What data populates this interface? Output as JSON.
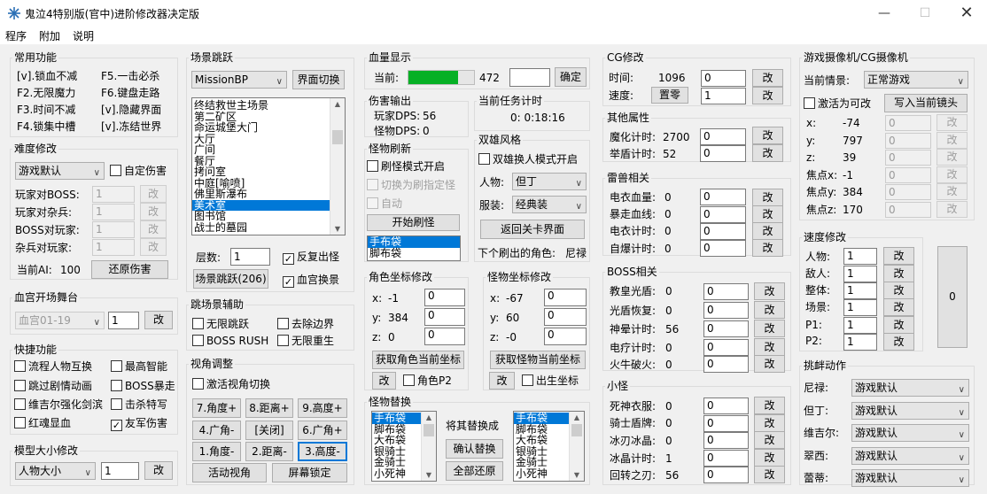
{
  "title": "鬼泣4特别版(官中)进阶修改器决定版",
  "menu": [
    "程序",
    "附加",
    "说明"
  ],
  "common": {
    "title": "常用功能",
    "items": [
      "[v].锁血不减",
      "F5.一击必杀",
      "F2.无限魔力",
      "F6.键盘走路",
      "F3.时间不减",
      "[v].隐藏界面",
      "F4.锁集中槽",
      "[v].冻结世界"
    ]
  },
  "diff": {
    "title": "难度修改",
    "combo": "游戏默认",
    "custom": "自定伤害",
    "rows": [
      {
        "label": "玩家对BOSS:",
        "value": "1"
      },
      {
        "label": "玩家对杂兵:",
        "value": "1"
      },
      {
        "label": "BOSS对玩家:",
        "value": "1"
      },
      {
        "label": "杂兵对玩家:",
        "value": "1"
      }
    ],
    "ai_label": "当前AI:",
    "ai_value": "100",
    "reset": "还原伤害"
  },
  "change": "改",
  "blood_palace": {
    "title": "血宫开场舞台",
    "combo": "血宫01-19",
    "value": "1"
  },
  "quick": {
    "title": "快捷功能",
    "items": [
      "流程人物互换",
      "最高智能",
      "跳过剧情动画",
      "BOSS暴走",
      "维吉尔强化剑滨",
      "击杀特写",
      "红魂显血",
      "友军伤害"
    ]
  },
  "model": {
    "title": "模型大小修改",
    "combo": "人物大小",
    "value": "1"
  },
  "scene": {
    "title": "场景跳跃",
    "combo": "MissionBP",
    "switch": "界面切换",
    "list": [
      "终结救世主场景",
      "第二矿区",
      "命运城堡大门",
      "大厅",
      "广间",
      "餐厅",
      "拷问室",
      "中庭[喻喷]",
      "佛里斯瀑布",
      "美术室",
      "图书馆",
      "战士的墓园"
    ],
    "floor_label": "层数:",
    "floor_value": "1",
    "repeat": "反复出怪",
    "blood": "血宫换景",
    "jump": "场景跳跃(206)"
  },
  "assist": {
    "title": "跳场景辅助",
    "items": [
      "无限跳跃",
      "去除边界",
      "BOSS RUSH",
      "无限重生"
    ]
  },
  "view": {
    "title": "视角调整",
    "activate": "激活视角切换",
    "buttons": [
      "7.角度+",
      "8.距离+",
      "9.高度+",
      "4.广角-",
      "[关闭]",
      "6.广角+",
      "1.角度-",
      "2.距离-",
      "3.高度-"
    ],
    "active": "活动视角",
    "lock": "屏幕锁定"
  },
  "hp": {
    "title": "血量显示",
    "label": "当前:",
    "value": "472",
    "confirm": "确定",
    "fill": 0.75
  },
  "dmg": {
    "title": "伤害输出",
    "player": "玩家DPS:",
    "player_val": "56",
    "monster": "怪物DPS:",
    "monster_val": "0"
  },
  "timer": {
    "title": "当前任务计时",
    "value": "0: 0:18:16"
  },
  "refresh": {
    "title": "怪物刷新",
    "mode": "刷怪模式开启",
    "switch": "切换为刷指定怪",
    "auto": "自动",
    "start": "开始刷怪",
    "list": [
      "手布袋",
      "脚布袋"
    ]
  },
  "dual": {
    "title": "双雄风格",
    "enable": "双雄换人模式开启",
    "char_label": "人物:",
    "char": "但丁",
    "costume_label": "服装:",
    "costume": "经典装",
    "back": "返回关卡界面",
    "next_label": "下个刷出的角色:",
    "next": "尼禄"
  },
  "role_pos": {
    "title": "角色坐标修改",
    "x": "-1",
    "y": "384",
    "z": "0",
    "get": "获取角色当前坐标",
    "p2": "角色P2"
  },
  "mon_pos": {
    "title": "怪物坐标修改",
    "x": "-67",
    "y": "60",
    "z": "-0",
    "get": "获取怪物当前坐标",
    "spawn": "出生坐标"
  },
  "replace": {
    "title": "怪物替换",
    "list": [
      "手布袋",
      "脚布袋",
      "大布袋",
      "银骑士",
      "金骑士",
      "小死神"
    ],
    "label": "将其替换成",
    "confirm": "确认替换",
    "restore": "全部还原",
    "list2": [
      "手布袋",
      "脚布袋",
      "大布袋",
      "银骑士",
      "金骑士",
      "小死神"
    ]
  },
  "cg": {
    "title": "CG修改",
    "time_label": "时间:",
    "time_val": "1096",
    "speed_label": "速度:",
    "zero": "置零",
    "time_in": "0",
    "speed_in": "1"
  },
  "attr": {
    "title": "其他属性",
    "rows": [
      {
        "label": "魔化计时:",
        "val": "2700",
        "input": "0"
      },
      {
        "label": "举盾计时:",
        "val": "52",
        "input": "0"
      }
    ]
  },
  "thunder": {
    "title": "雷兽相关",
    "rows": [
      {
        "label": "电衣血量:",
        "val": "0",
        "input": "0"
      },
      {
        "label": "暴走血线:",
        "val": "0",
        "input": "0"
      },
      {
        "label": "电衣计时:",
        "val": "0",
        "input": "0"
      },
      {
        "label": "自爆计时:",
        "val": "0",
        "input": "0"
      }
    ]
  },
  "boss": {
    "title": "BOSS相关",
    "rows": [
      {
        "label": "教皇光盾:",
        "val": "0",
        "input": "0"
      },
      {
        "label": "光盾恢复:",
        "val": "0",
        "input": "0"
      },
      {
        "label": "神晕计时:",
        "val": "56",
        "input": "0"
      },
      {
        "label": "电疗计时:",
        "val": "0",
        "input": "0"
      },
      {
        "label": "火牛破火:",
        "val": "0",
        "input": "0"
      }
    ]
  },
  "minion": {
    "title": "小怪",
    "rows": [
      {
        "label": "死神衣服:",
        "val": "0",
        "input": "0"
      },
      {
        "label": "骑士盾牌:",
        "val": "0",
        "input": "0"
      },
      {
        "label": "冰刃冰晶:",
        "val": "0",
        "input": "0"
      },
      {
        "label": "冰晶计时:",
        "val": "1",
        "input": "0"
      },
      {
        "label": "回转之刃:",
        "val": "56",
        "input": "0"
      }
    ]
  },
  "cam": {
    "title": "游戏摄像机/CG摄像机",
    "scene_label": "当前情景:",
    "scene": "正常游戏",
    "activate": "激活为可改",
    "write": "写入当前镜头",
    "rows": [
      {
        "label": "x:",
        "val": "-74",
        "input": "0"
      },
      {
        "label": "y:",
        "val": "797",
        "input": "0"
      },
      {
        "label": "z:",
        "val": "39",
        "input": "0"
      },
      {
        "label": "焦点x:",
        "val": "-1",
        "input": "0"
      },
      {
        "label": "焦点y:",
        "val": "384",
        "input": "0"
      },
      {
        "label": "焦点z:",
        "val": "170",
        "input": "0"
      }
    ]
  },
  "speed": {
    "title": "速度修改",
    "rows": [
      {
        "label": "人物:",
        "input": "1"
      },
      {
        "label": "敌人:",
        "input": "1"
      },
      {
        "label": "整体:",
        "input": "1"
      },
      {
        "label": "场景:",
        "input": "1"
      },
      {
        "label": "P1:",
        "input": "1"
      },
      {
        "label": "P2:",
        "input": "1"
      }
    ],
    "side": "0"
  },
  "taunt": {
    "title": "挑衅动作",
    "rows": [
      {
        "label": "尼禄:",
        "val": "游戏默认"
      },
      {
        "label": "但丁:",
        "val": "游戏默认"
      },
      {
        "label": "维吉尔:",
        "val": "游戏默认"
      },
      {
        "label": "翠西:",
        "val": "游戏默认"
      },
      {
        "label": "蕾蒂:",
        "val": "游戏默认"
      }
    ]
  }
}
